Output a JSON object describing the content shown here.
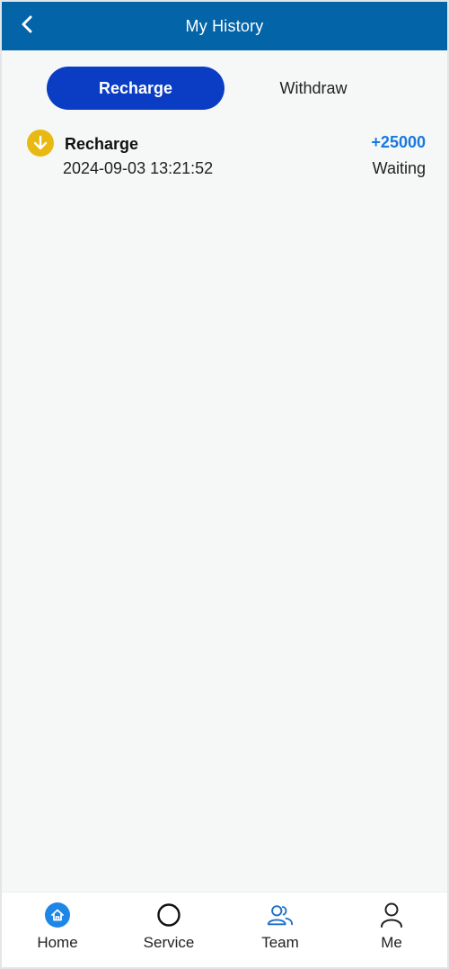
{
  "header": {
    "title": "My History"
  },
  "tabs": [
    {
      "label": "Recharge",
      "active": true
    },
    {
      "label": "Withdraw",
      "active": false
    }
  ],
  "records": [
    {
      "title": "Recharge",
      "datetime": "2024-09-03 13:21:52",
      "amount": "+25000",
      "status": "Waiting",
      "icon": "arrow-down-icon"
    }
  ],
  "nav": {
    "items": [
      {
        "label": "Home",
        "icon": "home-icon"
      },
      {
        "label": "Service",
        "icon": "service-icon"
      },
      {
        "label": "Team",
        "icon": "team-icon"
      },
      {
        "label": "Me",
        "icon": "user-icon"
      }
    ]
  },
  "colors": {
    "header_bg": "#0464a8",
    "tab_active_bg": "#0a3cc4",
    "amount": "#1a78df",
    "record_icon_bg": "#e9b913"
  }
}
